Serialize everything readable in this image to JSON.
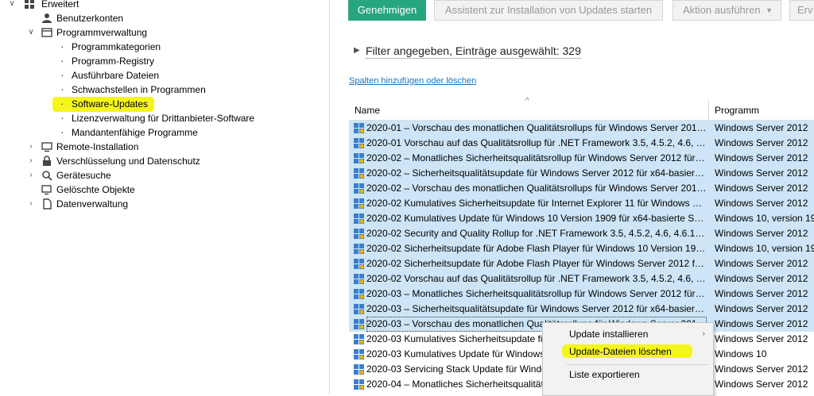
{
  "tree": {
    "root": {
      "label": "Erweitert"
    },
    "items": [
      {
        "label": "Benutzerkonten"
      },
      {
        "label": "Programmverwaltung"
      },
      {
        "label": "Programmkategorien"
      },
      {
        "label": "Programm-Registry"
      },
      {
        "label": "Ausführbare Dateien"
      },
      {
        "label": "Schwachstellen in Programmen"
      },
      {
        "label": "Software-Updates"
      },
      {
        "label": "Lizenzverwaltung für Drittanbieter-Software"
      },
      {
        "label": "Mandantenfähige Programme"
      },
      {
        "label": "Remote-Installation"
      },
      {
        "label": "Verschlüsselung und Datenschutz"
      },
      {
        "label": "Gerätesuche"
      },
      {
        "label": "Gelöschte Objekte"
      },
      {
        "label": "Datenverwaltung"
      }
    ]
  },
  "toolbar": {
    "approve": "Genehmigen",
    "wizard": "Assistent zur Installation von Updates starten",
    "action": "Aktion ausführen",
    "cut": "Erv"
  },
  "filter": {
    "text": "Filter angegeben, Einträge ausgewählt: 329"
  },
  "columns_link": "Spalten hinzufügen oder löschen",
  "table": {
    "headers": {
      "name": "Name",
      "program": "Programm"
    },
    "rows": [
      {
        "name": "2020-01 – Vorschau des monatlichen Qualitätsrollups für Windows Server 2012 f...",
        "program": "Windows Server 2012"
      },
      {
        "name": "2020-01 Vorschau auf das Qualitätsrollup für .NET Framework 3.5, 4.5.2, 4.6, 4.6....",
        "program": "Windows Server 2012"
      },
      {
        "name": "2020-02 – Monatliches Sicherheitsqualitätsrollup für Windows Server 2012 für x6...",
        "program": "Windows Server 2012"
      },
      {
        "name": "2020-02 – Sicherheitsqualitätsupdate für Windows Server 2012 für x64-basierte S...",
        "program": "Windows Server 2012"
      },
      {
        "name": "2020-02 – Vorschau des monatlichen Qualitätsrollups für Windows Server 2012 f...",
        "program": "Windows Server 2012"
      },
      {
        "name": "2020-02 Kumulatives Sicherheitsupdate für Internet Explorer 11 für Windows Ser...",
        "program": "Windows Server 2012"
      },
      {
        "name": "2020-02 Kumulatives Update für Windows 10 Version 1909 für x64-basierte Syste...",
        "program": "Windows 10, version 19..."
      },
      {
        "name": "2020-02 Security and Quality Rollup for .NET Framework 3.5, 4.5.2, 4.6, 4.6.1, 4.6....",
        "program": "Windows Server 2012"
      },
      {
        "name": "2020-02 Sicherheitsupdate für Adobe Flash Player für Windows 10 Version 1909 ...",
        "program": "Windows 10, version 19..."
      },
      {
        "name": "2020-02 Sicherheitsupdate für Adobe Flash Player für Windows Server 2012 für x...",
        "program": "Windows Server 2012"
      },
      {
        "name": "2020-02 Vorschau auf das Qualitätsrollup für .NET Framework 3.5, 4.5.2, 4.6, 4.6....",
        "program": "Windows Server 2012"
      },
      {
        "name": "2020-03 – Monatliches Sicherheitsqualitätsrollup für Windows Server 2012 für x6...",
        "program": "Windows Server 2012"
      },
      {
        "name": "2020-03 – Sicherheitsqualitätsupdate für Windows Server 2012 für x64-basierte S...",
        "program": "Windows Server 2012"
      },
      {
        "name": "2020-03 – Vorschau des monatlichen Qualitätsrollups für Windows Server 2012 f...",
        "program": "Windows Server 2012"
      },
      {
        "name": "2020-03 Kumulatives Sicherheitsupdate für",
        "program": "Windows Server 2012"
      },
      {
        "name": "2020-03 Kumulatives Update für Windows",
        "program": "Windows 10"
      },
      {
        "name": "2020-03 Servicing Stack Update für Windo",
        "program": "Windows Server 2012"
      },
      {
        "name": "2020-04 – Monatliches Sicherheitsqualitätsrollup für Windows Server 2012 für x6...",
        "program": "Windows Server 2012"
      }
    ]
  },
  "context_menu": {
    "install": "Update installieren",
    "delete": "Update-Dateien löschen",
    "export": "Liste exportieren"
  },
  "colors": {
    "accent": "#27a57f",
    "selection": "#cde5f7",
    "highlight": "#f5f51e",
    "link": "#1a73b8"
  }
}
